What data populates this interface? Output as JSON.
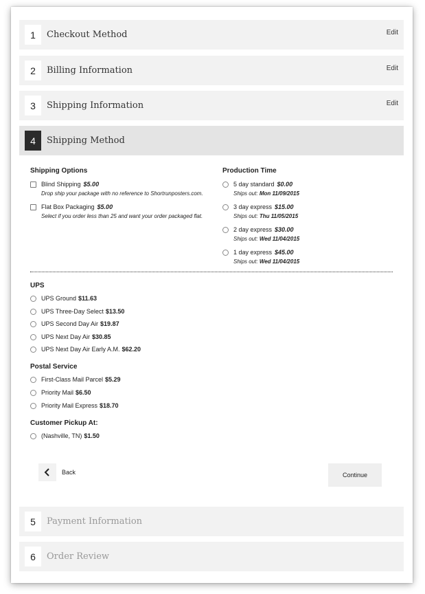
{
  "steps": [
    {
      "num": "1",
      "title": "Checkout Method",
      "edit": "Edit"
    },
    {
      "num": "2",
      "title": "Billing Information",
      "edit": "Edit"
    },
    {
      "num": "3",
      "title": "Shipping Information",
      "edit": "Edit"
    },
    {
      "num": "4",
      "title": "Shipping Method"
    },
    {
      "num": "5",
      "title": "Payment Information"
    },
    {
      "num": "6",
      "title": "Order Review"
    }
  ],
  "shipping_options": {
    "heading": "Shipping Options",
    "items": [
      {
        "label": "Blind Shipping",
        "price": "$5.00",
        "note": "Drop ship your package with no reference to Shortrunposters.com."
      },
      {
        "label": "Flat Box Packaging",
        "price": "$5.00",
        "note": "Select if you order less than 25 and want your order packaged flat."
      }
    ]
  },
  "production_time": {
    "heading": "Production Time",
    "ships_prefix": "Ships out:",
    "items": [
      {
        "label": "5 day standard",
        "price": "$0.00",
        "date": "Mon 11/09/2015"
      },
      {
        "label": "3 day express",
        "price": "$15.00",
        "date": "Thu 11/05/2015"
      },
      {
        "label": "2 day express",
        "price": "$30.00",
        "date": "Wed 11/04/2015"
      },
      {
        "label": "1 day express",
        "price": "$45.00",
        "date": "Wed 11/04/2015"
      }
    ]
  },
  "ups": {
    "heading": "UPS",
    "items": [
      {
        "label": "UPS Ground",
        "price": "$11.63"
      },
      {
        "label": "UPS Three-Day Select",
        "price": "$13.50"
      },
      {
        "label": "UPS Second Day Air",
        "price": "$19.87"
      },
      {
        "label": "UPS Next Day Air",
        "price": "$30.85"
      },
      {
        "label": "UPS Next Day Air Early A.M.",
        "price": "$62.20"
      }
    ]
  },
  "postal": {
    "heading": "Postal Service",
    "items": [
      {
        "label": "First-Class Mail Parcel",
        "price": "$5.29"
      },
      {
        "label": "Priority Mail",
        "price": "$6.50"
      },
      {
        "label": "Priority Mail Express",
        "price": "$18.70"
      }
    ]
  },
  "pickup": {
    "heading": "Customer Pickup At:",
    "items": [
      {
        "label": "(Nashville, TN)",
        "price": "$1.50"
      }
    ]
  },
  "buttons": {
    "back": "Back",
    "continue": "Continue"
  }
}
